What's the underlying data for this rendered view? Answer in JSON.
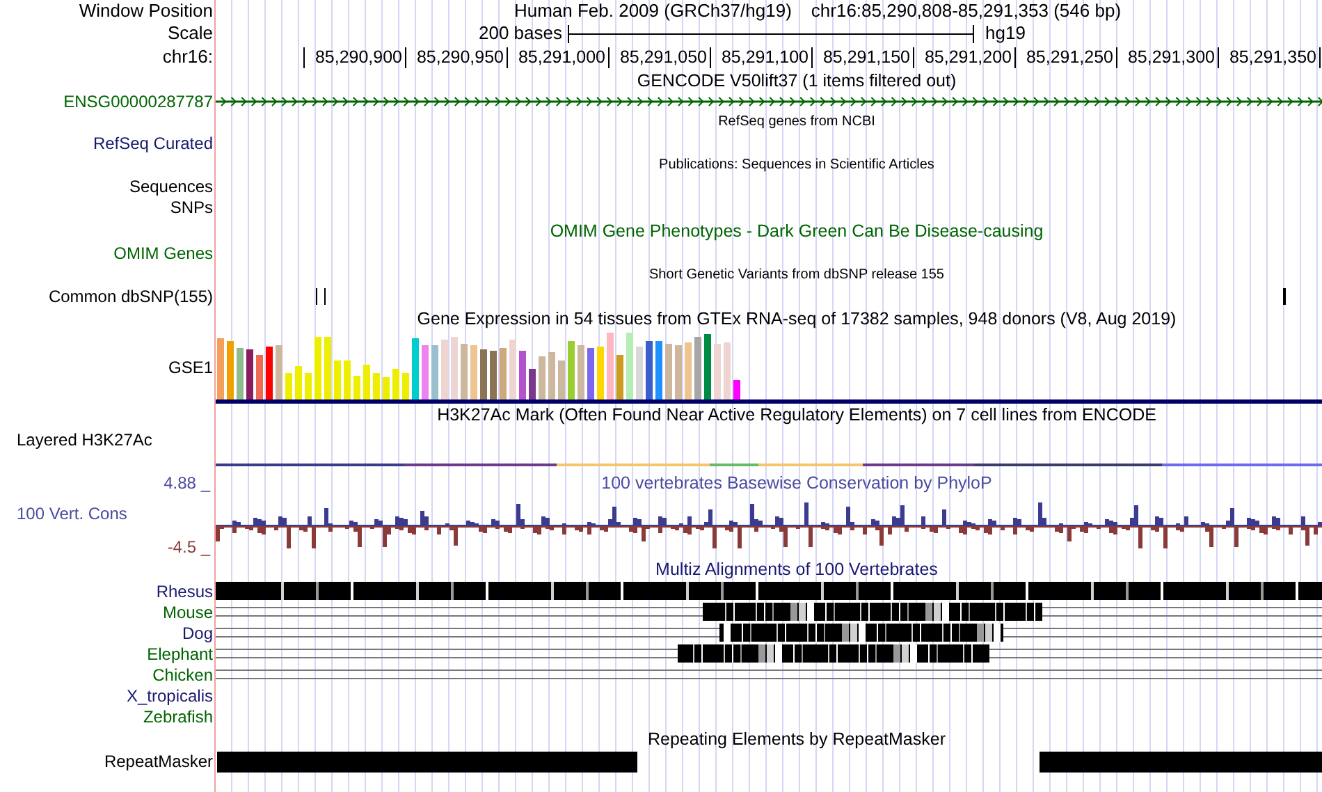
{
  "header": {
    "window_position_label": "Window Position",
    "assembly": "Human Feb. 2009 (GRCh37/hg19)",
    "position": "chr16:85,290,808-85,291,353 (546 bp)",
    "scale_label": "Scale",
    "scale_text": "200 bases",
    "scale_db": "hg19",
    "chrom_label": "chr16:",
    "ticks": [
      "85,290,900",
      "85,290,950",
      "85,291,000",
      "85,291,050",
      "85,291,100",
      "85,291,150",
      "85,291,200",
      "85,291,250",
      "85,291,300",
      "85,291,350"
    ]
  },
  "tracks": [
    {
      "kind": "gene",
      "title": {
        "text": "GENCODE V50lift37 (1 items filtered out)",
        "compact": false,
        "color": "#000000"
      },
      "label_lines": [
        "ENSG00000287787"
      ],
      "color": "#006400"
    },
    {
      "kind": "empty",
      "title": {
        "text": "RefSeq genes from NCBI",
        "compact": true,
        "color": "#000000"
      },
      "label_lines": [
        "RefSeq Curated"
      ],
      "color": "#191970"
    },
    {
      "kind": "empty",
      "title": {
        "text": "Publications: Sequences in Scientific Articles",
        "compact": true,
        "color": "#000000"
      },
      "label_lines": [
        "Sequences",
        "SNPs"
      ],
      "color": "#000000"
    },
    {
      "kind": "empty",
      "title": {
        "text": "OMIM Gene Phenotypes - Dark Green Can Be Disease-causing",
        "compact": false,
        "color": "#006400"
      },
      "label_lines": [
        "OMIM Genes"
      ],
      "color": "#006400"
    },
    {
      "kind": "snp",
      "title": {
        "text": "Short Genetic Variants from dbSNP release 155",
        "compact": true,
        "color": "#000000"
      },
      "label_lines": [
        "Common dbSNP(155)"
      ],
      "color": "#000000"
    },
    {
      "kind": "expression",
      "title": {
        "text": "Gene Expression in 54 tissues from GTEx RNA-seq of 17382 samples, 948 donors (V8, Aug 2019)",
        "compact": false,
        "color": "#000000"
      },
      "label_lines": [
        "GSE1"
      ],
      "color": "#000000"
    },
    {
      "kind": "layered",
      "title": {
        "text": "H3K27Ac Mark (Often Found Near Active Regulatory Elements) on 7 cell lines from ENCODE",
        "compact": false,
        "color": "#000000"
      },
      "label_lines": [
        "Layered H3K27Ac"
      ],
      "color": "#000000"
    },
    {
      "kind": "wiggle",
      "title": {
        "text": "100 vertebrates Basewise Conservation by PhyloP",
        "compact": false,
        "color": "#4b4ba0"
      },
      "label_lines": [
        "100 Vert. Cons"
      ],
      "color": "#4b4ba0",
      "max_label": "4.88 _",
      "min_label": "-4.5 _"
    },
    {
      "kind": "multiz",
      "title": {
        "text": "Multiz Alignments of 100 Vertebrates",
        "compact": false,
        "color": "#191970"
      },
      "species": [
        {
          "name": "Rhesus",
          "color": "#191970",
          "kind": "full"
        },
        {
          "name": "Mouse",
          "color": "#006400",
          "kind": "partial"
        },
        {
          "name": "Dog",
          "color": "#191970",
          "kind": "partial"
        },
        {
          "name": "Elephant",
          "color": "#006400",
          "kind": "partial"
        },
        {
          "name": "Chicken",
          "color": "#006400",
          "kind": "gap"
        },
        {
          "name": "X_tropicalis",
          "color": "#191970",
          "kind": "none"
        },
        {
          "name": "Zebrafish",
          "color": "#006400",
          "kind": "none"
        }
      ]
    },
    {
      "kind": "repeat",
      "title": {
        "text": "Repeating Elements by RepeatMasker",
        "compact": false,
        "color": "#000000"
      },
      "label_lines": [
        "RepeatMasker"
      ],
      "color": "#000000"
    }
  ]
}
